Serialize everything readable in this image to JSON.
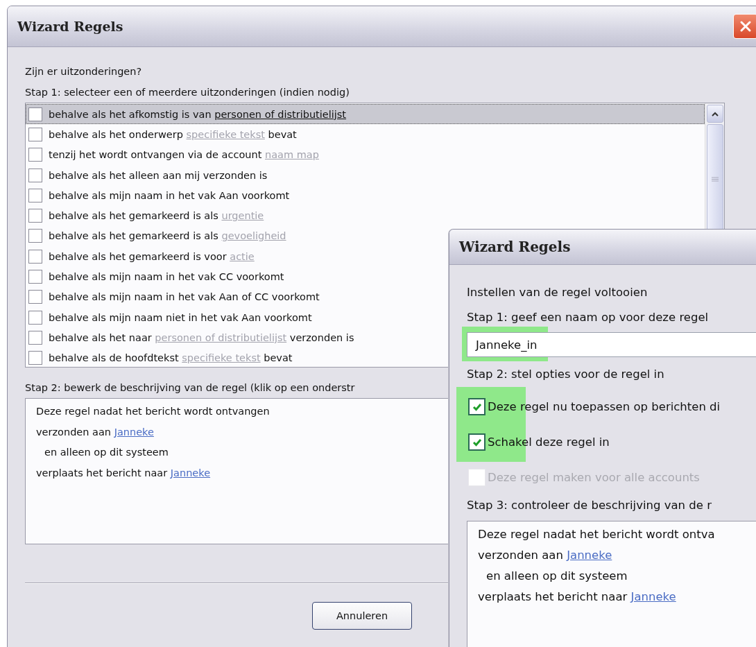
{
  "back_window": {
    "title": "Wizard Regels",
    "heading": "Zijn er uitzonderingen?",
    "step1_label": "Stap 1: selecteer een of meerdere uitzonderingen (indien nodig)",
    "exceptions": [
      {
        "checked": false,
        "selected": true,
        "parts": [
          {
            "text": "behalve als het afkomstig is van "
          },
          {
            "text": "personen of distributielijst",
            "link": true
          }
        ]
      },
      {
        "checked": false,
        "selected": false,
        "parts": [
          {
            "text": "behalve als het onderwerp "
          },
          {
            "text": "specifieke tekst",
            "link": true
          },
          {
            "text": " bevat"
          }
        ]
      },
      {
        "checked": false,
        "selected": false,
        "parts": [
          {
            "text": "tenzij het wordt ontvangen via de account "
          },
          {
            "text": "naam map",
            "link": true
          }
        ]
      },
      {
        "checked": false,
        "selected": false,
        "parts": [
          {
            "text": "behalve als het alleen aan mij verzonden is"
          }
        ]
      },
      {
        "checked": false,
        "selected": false,
        "parts": [
          {
            "text": "behalve als mijn naam in het vak Aan voorkomt"
          }
        ]
      },
      {
        "checked": false,
        "selected": false,
        "parts": [
          {
            "text": "behalve als het gemarkeerd is als "
          },
          {
            "text": "urgentie",
            "link": true
          }
        ]
      },
      {
        "checked": false,
        "selected": false,
        "parts": [
          {
            "text": "behalve als het gemarkeerd is als "
          },
          {
            "text": "gevoeligheid",
            "link": true
          }
        ]
      },
      {
        "checked": false,
        "selected": false,
        "parts": [
          {
            "text": "behalve als het gemarkeerd is voor "
          },
          {
            "text": "actie",
            "link": true
          }
        ]
      },
      {
        "checked": false,
        "selected": false,
        "parts": [
          {
            "text": "behalve als mijn naam in het vak CC voorkomt"
          }
        ]
      },
      {
        "checked": false,
        "selected": false,
        "parts": [
          {
            "text": "behalve als mijn naam in het vak Aan of CC voorkomt"
          }
        ]
      },
      {
        "checked": false,
        "selected": false,
        "parts": [
          {
            "text": "behalve als mijn naam niet in het vak Aan voorkomt"
          }
        ]
      },
      {
        "checked": false,
        "selected": false,
        "parts": [
          {
            "text": "behalve als het naar "
          },
          {
            "text": "personen of distributielijst",
            "link": true
          },
          {
            "text": " verzonden is"
          }
        ]
      },
      {
        "checked": false,
        "selected": false,
        "parts": [
          {
            "text": "behalve als de hoofdtekst "
          },
          {
            "text": "specifieke tekst",
            "link": true
          },
          {
            "text": " bevat"
          }
        ]
      }
    ],
    "step2_label": "Stap 2: bewerk de beschrijving van de regel (klik op een onderstr",
    "description": [
      {
        "indented": false,
        "parts": [
          {
            "text": "Deze regel nadat het bericht wordt ontvangen"
          }
        ]
      },
      {
        "indented": false,
        "parts": [
          {
            "text": "verzonden aan "
          },
          {
            "text": "Janneke",
            "link": true
          }
        ]
      },
      {
        "indented": true,
        "parts": [
          {
            "text": "en alleen op dit systeem"
          }
        ]
      },
      {
        "indented": false,
        "parts": [
          {
            "text": "verplaats het bericht naar "
          },
          {
            "text": "Janneke",
            "link": true
          }
        ]
      }
    ],
    "buttons": [
      "Annuleren"
    ]
  },
  "front_window": {
    "title": "Wizard Regels",
    "intro": "Instellen van de regel voltooien",
    "step1_label": "Stap 1: geef een naam op voor deze regel",
    "rule_name": {
      "value": "Janneke_in",
      "highlighted": true
    },
    "step2_label": "Stap 2: stel opties voor de regel in",
    "options": [
      {
        "label": "Deze regel nu toepassen op berichten di",
        "checked": true,
        "disabled": false,
        "highlighted": true
      },
      {
        "label": "Schakel deze regel in",
        "checked": true,
        "disabled": false,
        "highlighted": true
      },
      {
        "label": "Deze regel maken voor alle accounts",
        "checked": false,
        "disabled": true,
        "highlighted": false
      }
    ],
    "step3_label": "Stap 3: controleer de beschrijving van de r",
    "description": [
      {
        "indented": false,
        "parts": [
          {
            "text": "Deze regel nadat het bericht wordt ontva"
          }
        ]
      },
      {
        "indented": false,
        "parts": [
          {
            "text": "verzonden aan "
          },
          {
            "text": "Janneke",
            "link": true
          }
        ]
      },
      {
        "indented": true,
        "parts": [
          {
            "text": "en alleen op dit systeem"
          }
        ]
      },
      {
        "indented": false,
        "parts": [
          {
            "text": "verplaats het bericht naar "
          },
          {
            "text": "Janneke",
            "link": true
          }
        ]
      }
    ]
  }
}
